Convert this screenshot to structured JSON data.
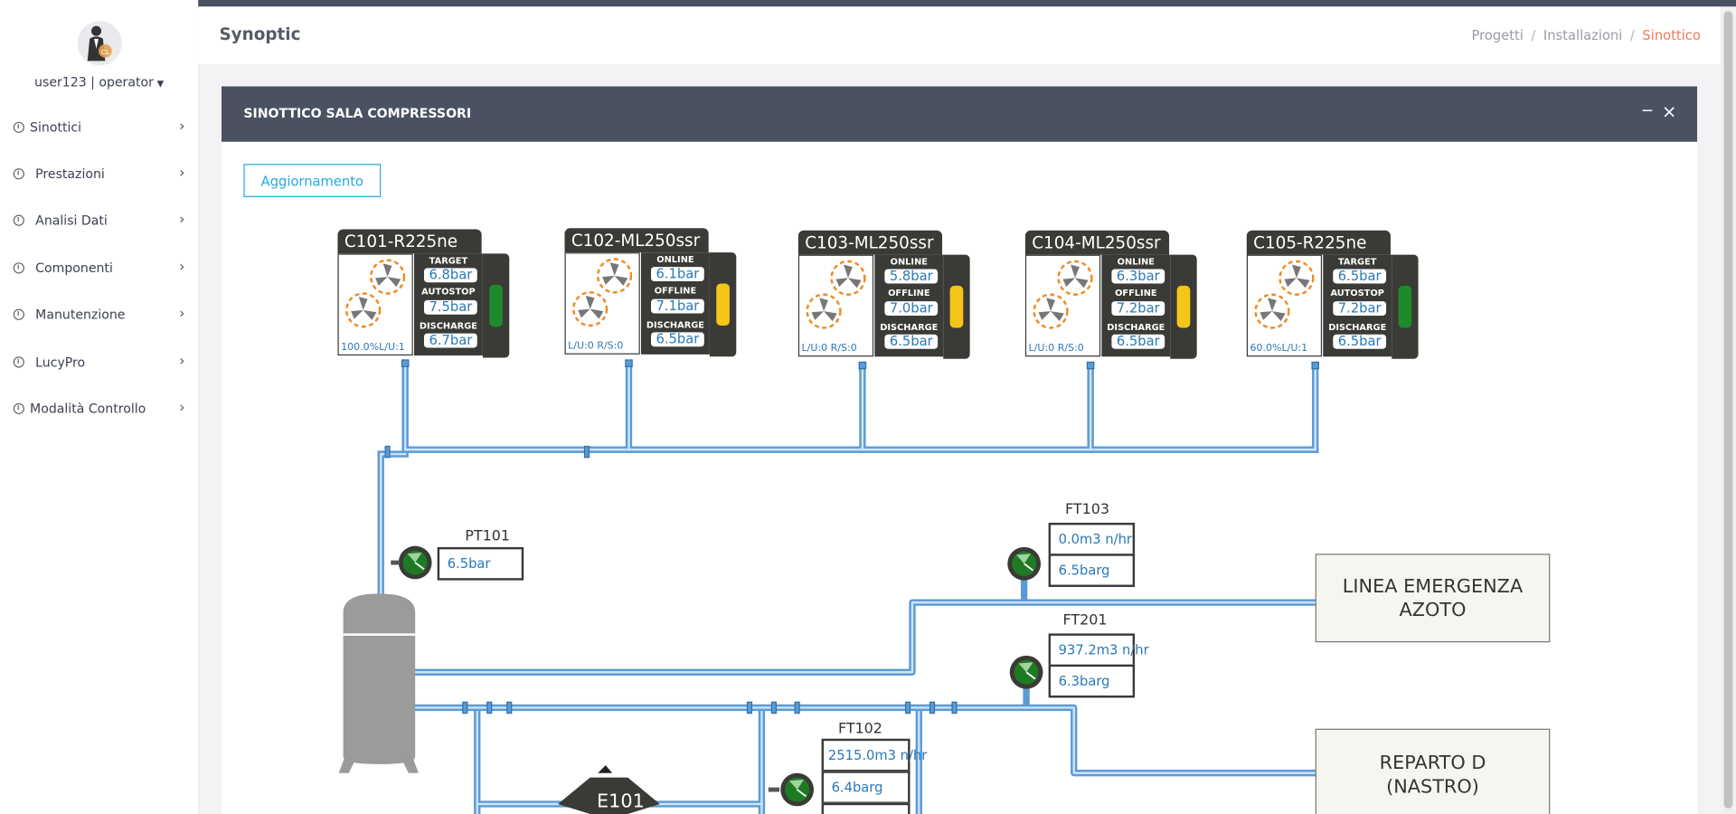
{
  "user": {
    "name": "user123 | operator"
  },
  "nav": {
    "items": [
      {
        "label": "Sinottici"
      },
      {
        "label": "Prestazioni"
      },
      {
        "label": "Analisi Dati"
      },
      {
        "label": "Componenti"
      },
      {
        "label": "Manutenzione"
      },
      {
        "label": "LucyPro"
      },
      {
        "label": "Modalità Controllo"
      }
    ]
  },
  "header": {
    "title": "Synoptic",
    "breadcrumb": [
      "Progetti",
      "Installazioni",
      "Sinottico"
    ]
  },
  "panel": {
    "title": "SINOTTICO SALA COMPRESSORI",
    "refresh_label": "Aggiornamento"
  },
  "compressors": [
    {
      "name": "C101-R225ne",
      "status": "100.0%L/U:1",
      "labels": [
        "TARGET",
        "AUTOSTOP",
        "DISCHARGE"
      ],
      "values": [
        "6.8bar",
        "7.5bar",
        "6.7bar"
      ],
      "lamp": "#1e8a2a"
    },
    {
      "name": "C102-ML250ssr",
      "status": "L/U:0 R/S:0",
      "labels": [
        "ONLINE",
        "OFFLINE",
        "DISCHARGE"
      ],
      "values": [
        "6.1bar",
        "7.1bar",
        "6.5bar"
      ],
      "lamp": "#f5c518"
    },
    {
      "name": "C103-ML250ssr",
      "status": "L/U:0 R/S:0",
      "labels": [
        "ONLINE",
        "OFFLINE",
        "DISCHARGE"
      ],
      "values": [
        "5.8bar",
        "7.0bar",
        "6.5bar"
      ],
      "lamp": "#f5c518"
    },
    {
      "name": "C104-ML250ssr",
      "status": "L/U:0 R/S:0",
      "labels": [
        "ONLINE",
        "OFFLINE",
        "DISCHARGE"
      ],
      "values": [
        "6.3bar",
        "7.2bar",
        "6.5bar"
      ],
      "lamp": "#f5c518"
    },
    {
      "name": "C105-R225ne",
      "status": "60.0%L/U:1",
      "labels": [
        "TARGET",
        "AUTOSTOP",
        "DISCHARGE"
      ],
      "values": [
        "6.5bar",
        "7.2bar",
        "6.5bar"
      ],
      "lamp": "#1e8a2a"
    }
  ],
  "instruments": {
    "pt101": {
      "tag": "PT101",
      "value": "6.5bar"
    },
    "ft103": {
      "tag": "FT103",
      "flow": "0.0m3 n/hr",
      "pressure": "6.5barg"
    },
    "ft201": {
      "tag": "FT201",
      "flow": "937.2m3 n/hr",
      "pressure": "6.3barg"
    },
    "ft102": {
      "tag": "FT102",
      "flow": "2515.0m3 n/hr",
      "pressure": "6.4barg"
    }
  },
  "destinations": {
    "emergency": "LINEA EMERGENZA AZOTO",
    "reparto": "REPARTO D (NASTRO)"
  },
  "equipment": {
    "e101": "E101"
  },
  "colors": {
    "pipe": "#5b9bd5",
    "pipe_light": "#cfe3f7",
    "tank": "#9b9b99",
    "header": "#4a5161",
    "accent": "#f0785e"
  }
}
